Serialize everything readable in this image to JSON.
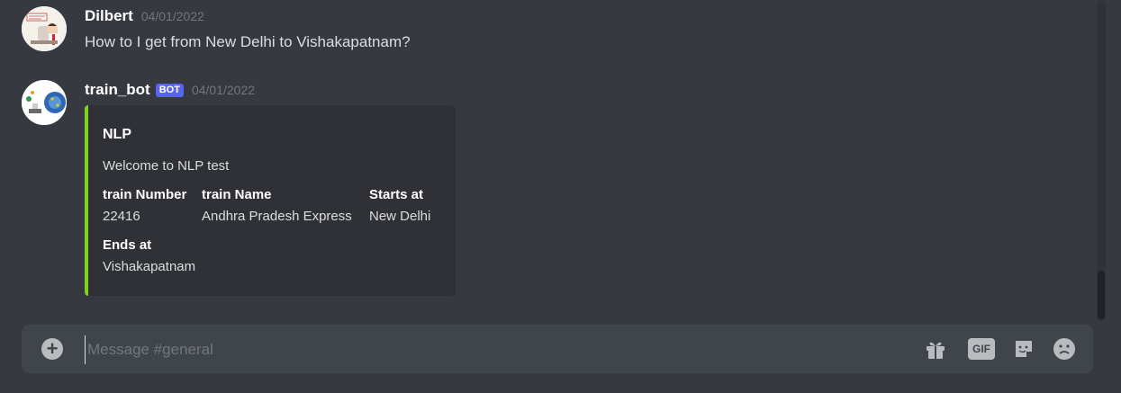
{
  "messages": [
    {
      "username": "Dilbert",
      "timestamp": "04/01/2022",
      "text": "How to I get from New Delhi to Vishakapatnam?",
      "avatar_icon": "dilbert-avatar"
    },
    {
      "username": "train_bot",
      "badge": "BOT",
      "timestamp": "04/01/2022",
      "avatar_icon": "bot-avatar",
      "embed": {
        "accent_color": "#7ed321",
        "title": "NLP",
        "description": "Welcome to NLP test",
        "fields": [
          {
            "name": "train Number",
            "value": "22416"
          },
          {
            "name": "train Name",
            "value": "Andhra Pradesh Express"
          },
          {
            "name": "Starts at",
            "value": "New Delhi"
          },
          {
            "name": "Ends at",
            "value": "Vishakapatnam"
          }
        ]
      }
    }
  ],
  "composer": {
    "placeholder": "Message #general",
    "gif_label": "GIF",
    "icons": [
      "add-icon",
      "gift-icon",
      "gif-icon",
      "sticker-icon",
      "emoji-icon"
    ]
  },
  "colors": {
    "background": "#36393f",
    "embed_background": "#2f3136",
    "bot_badge": "#5865f2",
    "composer": "#40444b"
  }
}
